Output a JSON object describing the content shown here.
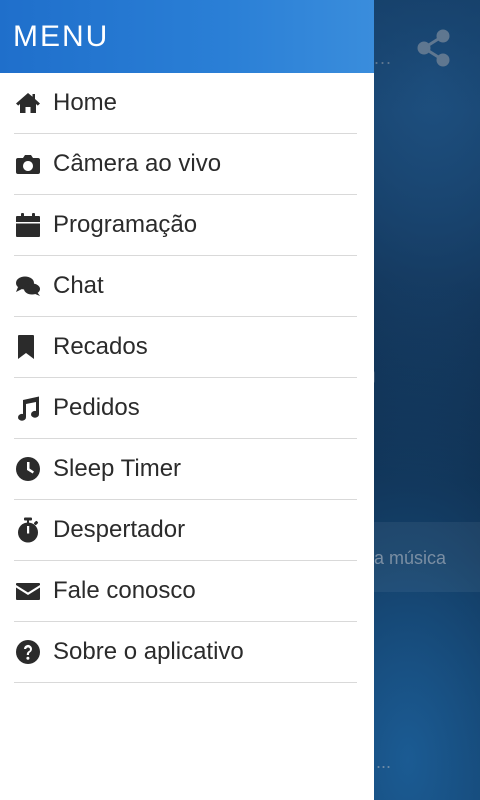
{
  "drawer": {
    "title": "MENU",
    "items": [
      {
        "label": "Home",
        "icon": "home-icon"
      },
      {
        "label": "Câmera ao vivo",
        "icon": "camera-icon"
      },
      {
        "label": "Programação",
        "icon": "calendar-icon"
      },
      {
        "label": "Chat",
        "icon": "chat-icon"
      },
      {
        "label": "Recados",
        "icon": "bookmark-icon"
      },
      {
        "label": "Pedidos",
        "icon": "music-icon"
      },
      {
        "label": "Sleep Timer",
        "icon": "clock-icon"
      },
      {
        "label": "Despertador",
        "icon": "stopwatch-icon"
      },
      {
        "label": "Fale conosco",
        "icon": "envelope-icon"
      },
      {
        "label": "Sobre o aplicativo",
        "icon": "question-icon"
      }
    ]
  },
  "background": {
    "strip_text": "a música",
    "dots": "...",
    "share_icon": "share-icon"
  },
  "colors": {
    "header": "#2a7fd6",
    "text": "#2b2b2b",
    "divider": "#d9d9d9"
  }
}
